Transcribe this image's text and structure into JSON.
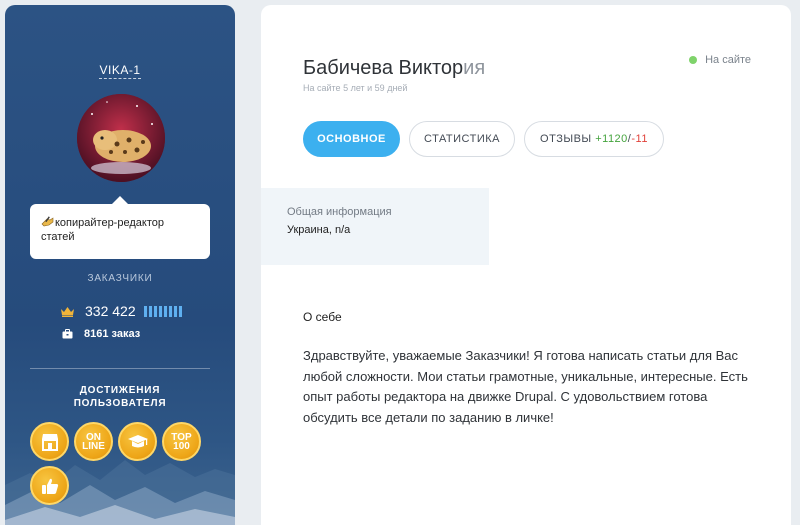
{
  "profile": {
    "username": "VIKA-1",
    "role": "копирайтер-редактор статей",
    "section_label": "ЗАКАЗЧИКИ",
    "rating": "332 422",
    "orders": "8161 заказ",
    "achievements_title_line1": "ДОСТИЖЕНИЯ",
    "achievements_title_line2": "ПОЛЬЗОВАТЕЛЯ",
    "badges": [
      {
        "icon": "shop-icon"
      },
      {
        "icon": "online-badge",
        "line1": "ON",
        "line2": "LINE"
      },
      {
        "icon": "graduation-cap-icon"
      },
      {
        "icon": "top100-badge",
        "line1": "TOP",
        "line2": "100"
      },
      {
        "icon": "thumbs-up-icon"
      }
    ]
  },
  "header": {
    "name_main": "Бабичева Виктор",
    "name_fade": "ия",
    "since": "На сайте 5 лет и 59 дней",
    "status": "На сайте",
    "status_color": "#7fd36b"
  },
  "tabs": {
    "main": "ОСНОВНОЕ",
    "stats": "СТАТИСТИКА",
    "reviews_label": "ОТЗЫВЫ",
    "reviews_pos": "+1120",
    "reviews_sep": "/",
    "reviews_neg": "-11"
  },
  "info": {
    "label": "Общая информация",
    "value": "Украина, n/a"
  },
  "about": {
    "title": "О себе",
    "text": "Здравствуйте, уважаемые Заказчики! Я готова написать статьи для Вас любой сложности. Мои статьи грамотные, уникальные, интересные. Есть опыт работы редактора на движке Drupal. С удовольствием готова обсудить все детали по заданию в личке!"
  },
  "colors": {
    "accent": "#3cb0ef",
    "sidebar": "#2a5080",
    "positive": "#44a33d",
    "negative": "#e0413a"
  }
}
